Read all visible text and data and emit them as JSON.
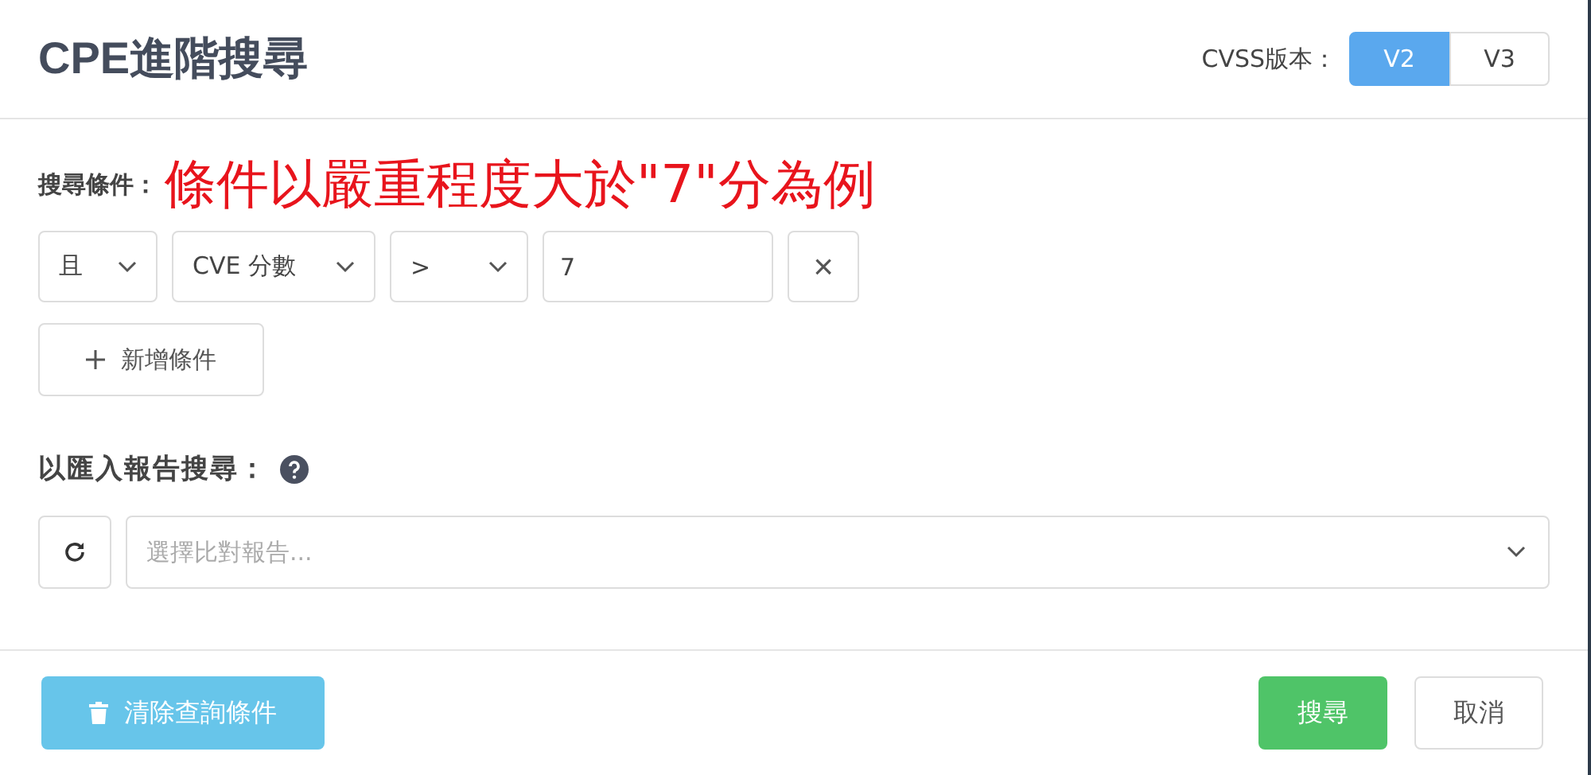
{
  "dialog": {
    "title": "CPE進階搜尋"
  },
  "cvss": {
    "label": "CVSS版本：",
    "options": [
      {
        "label": "V2",
        "selected": true
      },
      {
        "label": "V3",
        "selected": false
      }
    ]
  },
  "conditions": {
    "label": "搜尋條件：",
    "annotation": "條件以嚴重程度大於\"7\"分為例",
    "rows": [
      {
        "logic": "且",
        "field": "CVE 分數",
        "operator": ">",
        "value": "7",
        "remove": "×"
      }
    ],
    "add_button": "新增條件"
  },
  "report": {
    "label": "以匯入報告搜尋：",
    "placeholder": "選擇比對報告..."
  },
  "footer": {
    "clear_button": "清除查詢條件",
    "search_button": "搜尋",
    "cancel_button": "取消"
  }
}
